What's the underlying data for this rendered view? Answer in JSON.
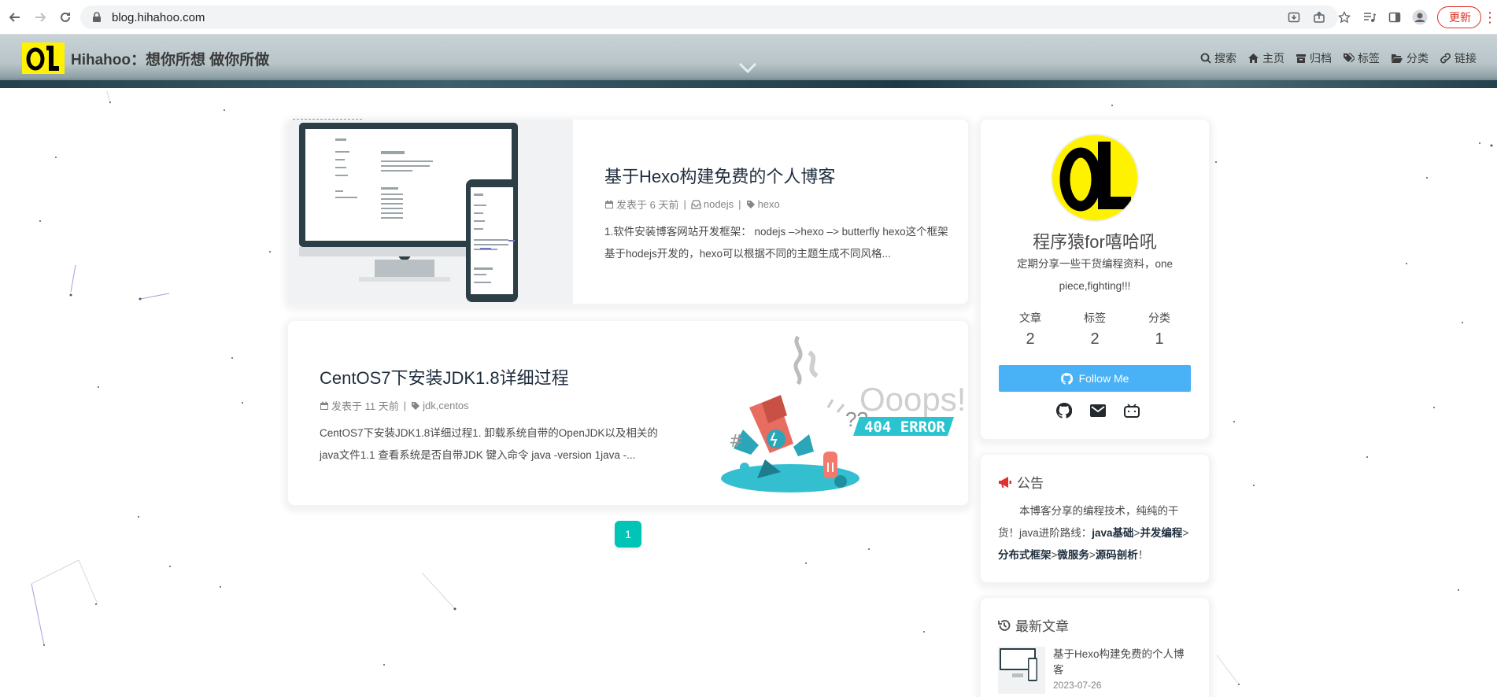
{
  "browser": {
    "url": "blog.hihahoo.com",
    "update_label": "更新"
  },
  "site": {
    "brand_name": "Hihahoo：想你所想 做你所做",
    "menu": [
      {
        "label": "搜索",
        "icon": "search-icon"
      },
      {
        "label": "主页",
        "icon": "home-icon"
      },
      {
        "label": "归档",
        "icon": "archive-icon"
      },
      {
        "label": "标签",
        "icon": "tags-icon"
      },
      {
        "label": "分类",
        "icon": "folder-open-icon"
      },
      {
        "label": "链接",
        "icon": "link-icon"
      }
    ]
  },
  "posts": [
    {
      "title": "基于Hexo构建免费的个人博客",
      "date": "发表于 6 天前",
      "category": "nodejs",
      "tags": "hexo",
      "excerpt": "1.软件安装博客网站开发框架： nodejs –>hexo –> butterfly hexo这个框架基于hodejs开发的，hexo可以根据不同的主题生成不同风格..."
    },
    {
      "title": "CentOS7下安装JDK1.8详细过程",
      "date": "发表于 11 天前",
      "tags": "jdk,centos",
      "excerpt": "CentOS7下安装JDK1.8详细过程1. 卸载系统自带的OpenJDK以及相关的java文件1.1 查看系统是否自带JDK 键入命令 java -version 1java -..."
    }
  ],
  "cover2": {
    "ooops": "Ooops!",
    "error": "404 ERROR"
  },
  "pagination": {
    "current": "1"
  },
  "author": {
    "name": "程序猿for嘻哈吼",
    "description": "定期分享一些干货编程资料，one piece,fighting!!!",
    "stats": [
      {
        "label": "文章",
        "value": "2"
      },
      {
        "label": "标签",
        "value": "2"
      },
      {
        "label": "分类",
        "value": "1"
      }
    ],
    "follow_label": "Follow Me"
  },
  "announcement": {
    "heading": "公告",
    "text_plain_1": "本博客分享的编程技术，纯纯的干货！java进阶路线：",
    "b1": "java基础",
    "arrow": ">",
    "b2": "并发编程",
    "b3": "分布式框架",
    "b4": "微服务",
    "b5": "源码剖析",
    "end": "！"
  },
  "recent": {
    "heading": "最新文章",
    "items": [
      {
        "title": "基于Hexo构建免费的个人博客",
        "date": "2023-07-26"
      }
    ]
  },
  "colors": {
    "accent": "#49b1f5",
    "pager": "#00c4b6",
    "logo_yellow": "#fff200",
    "update_red": "#d93025"
  }
}
